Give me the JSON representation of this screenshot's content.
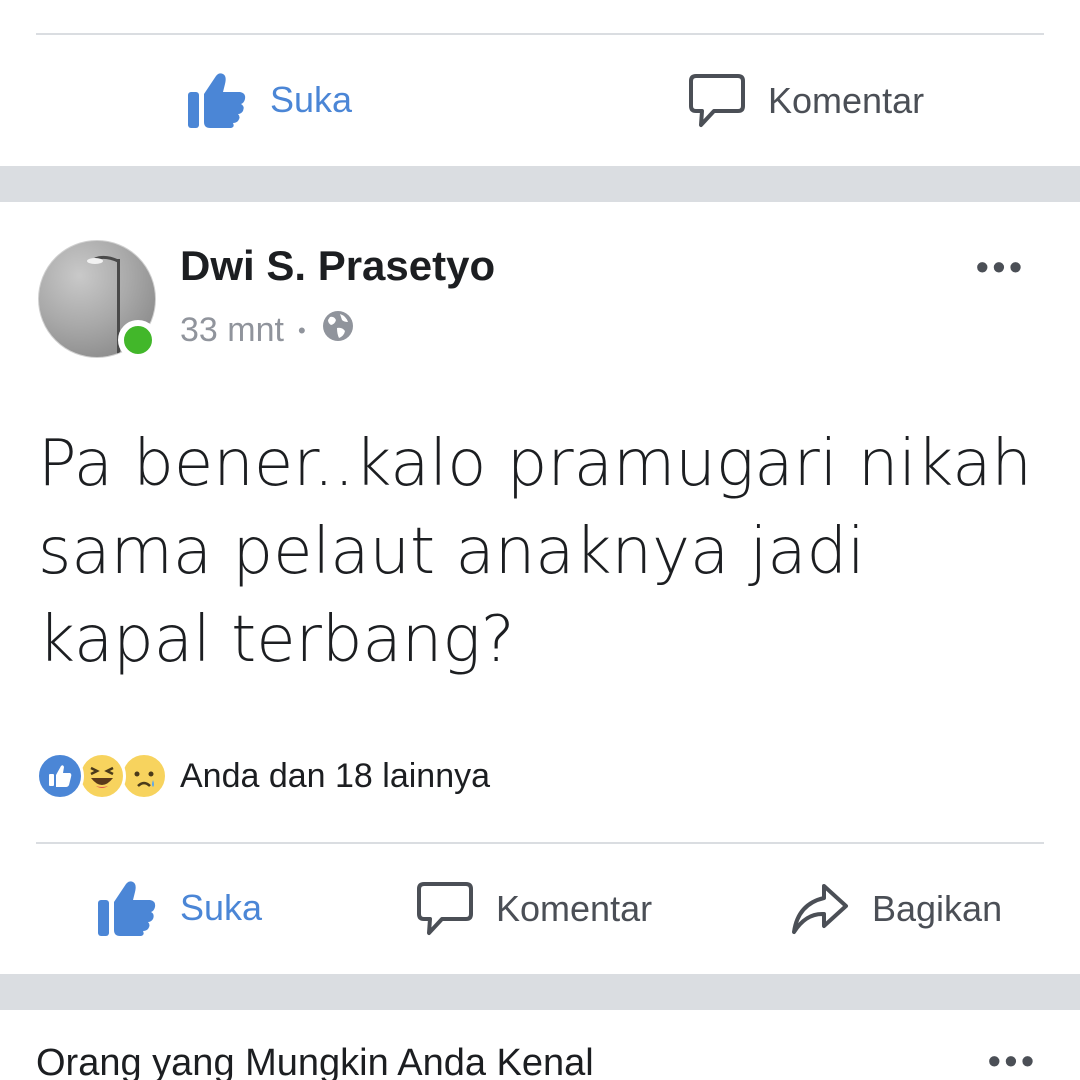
{
  "top_actions": {
    "like_label": "Suka",
    "comment_label": "Komentar"
  },
  "post": {
    "author": "Dwi S. Prasetyo",
    "time": "33 mnt",
    "separator": "•",
    "privacy_icon": "globe-icon",
    "text": "Pa bener..kalo pramugari nikah sama pelaut anaknya jadi kapal terbang?",
    "online": true,
    "reactions": {
      "icons": [
        "like-reaction-icon",
        "haha-reaction-icon",
        "sad-reaction-icon"
      ],
      "summary": "Anda dan 18 lainnya"
    },
    "actions": {
      "like_label": "Suka",
      "comment_label": "Komentar",
      "share_label": "Bagikan"
    }
  },
  "suggestions": {
    "title": "Orang yang Mungkin Anda Kenal"
  },
  "colors": {
    "like_blue": "#4b86d6",
    "online_green": "#42b72a",
    "divider": "#dadde1",
    "muted_text": "#90949c"
  }
}
